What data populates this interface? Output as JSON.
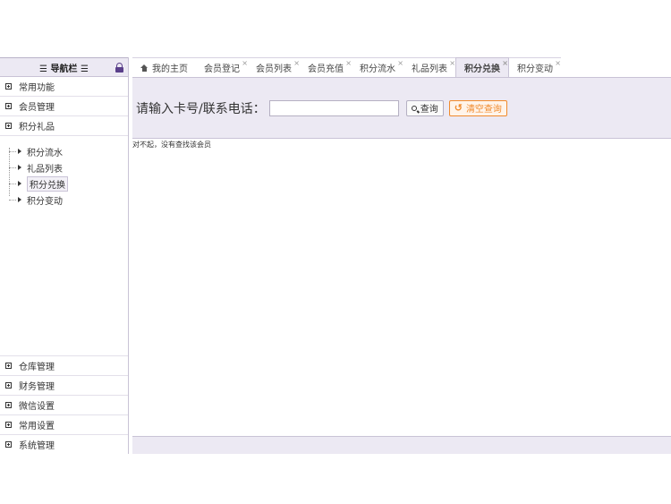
{
  "sidebar": {
    "title": "☰ 导航栏 ☰",
    "groups_top": [
      {
        "label": "常用功能"
      },
      {
        "label": "会员管理"
      },
      {
        "label": "积分礼品"
      }
    ],
    "tree_items": [
      {
        "label": "积分流水"
      },
      {
        "label": "礼品列表"
      },
      {
        "label": "积分兑换"
      },
      {
        "label": "积分变动"
      }
    ],
    "groups_bottom": [
      {
        "label": "仓库管理"
      },
      {
        "label": "财务管理"
      },
      {
        "label": "微信设置"
      },
      {
        "label": "常用设置"
      },
      {
        "label": "系统管理"
      }
    ]
  },
  "tabs": [
    {
      "label": "我的主页"
    },
    {
      "label": "会员登记"
    },
    {
      "label": "会员列表"
    },
    {
      "label": "会员充值"
    },
    {
      "label": "积分流水"
    },
    {
      "label": "礼品列表"
    },
    {
      "label": "积分兑换"
    },
    {
      "label": "积分变动"
    }
  ],
  "search": {
    "label": "请输入卡号/联系电话：",
    "value": "",
    "query_button": "查询",
    "clear_button": "清空查询"
  },
  "result": {
    "message": "对不起，没有查找该会员"
  },
  "close_glyph": "×"
}
